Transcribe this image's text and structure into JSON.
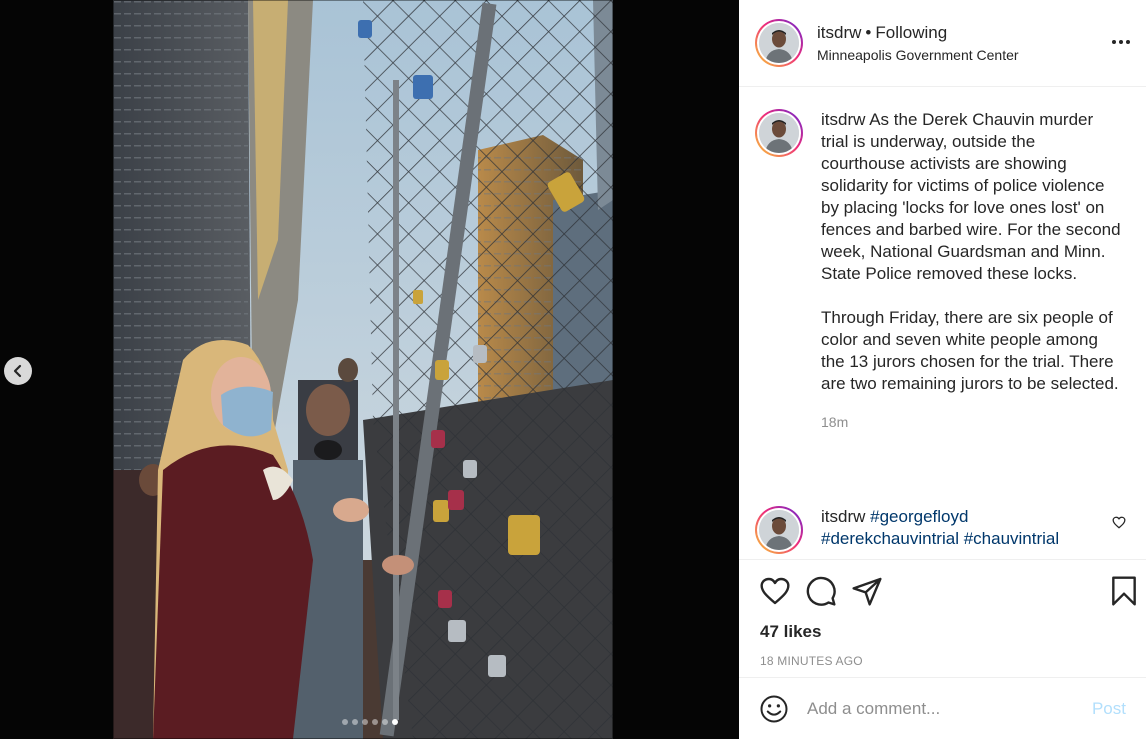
{
  "post": {
    "username": "itsdrw",
    "follow_status": "Following",
    "location": "Minneapolis Government Center",
    "caption": "As the Derek Chauvin murder trial is underway, outside the courthouse activists are showing solidarity for victims of police violence by placing 'locks for love ones lost' on fences and barbed wire. For the second week, National Guardsman and Minn. State Police removed these locks.\n\nThrough Friday, there are six people of color and seven white people among the 13 jurors chosen for the trial. There are two remaining jurors to be selected.",
    "caption_time": "18m",
    "likes": "47 likes",
    "time_ago": "18 MINUTES AGO"
  },
  "second_comment": {
    "username": "itsdrw",
    "tags": [
      "#georgefloyd",
      "#derekchauvintrial",
      "#chauvintrial"
    ]
  },
  "comment_box": {
    "placeholder": "Add a comment...",
    "post_label": "Post"
  },
  "carousel": {
    "total": 6,
    "active_index": 5
  },
  "icons": {
    "prev": "chevron-left-icon",
    "more": "more-options-icon",
    "like": "heart-icon",
    "comment": "comment-icon",
    "share": "share-icon",
    "save": "bookmark-icon",
    "emoji": "emoji-icon",
    "comment_like": "heart-icon"
  },
  "colors": {
    "link": "#00376b",
    "muted": "#8e8e8e",
    "post_disabled": "#b2dffc"
  }
}
